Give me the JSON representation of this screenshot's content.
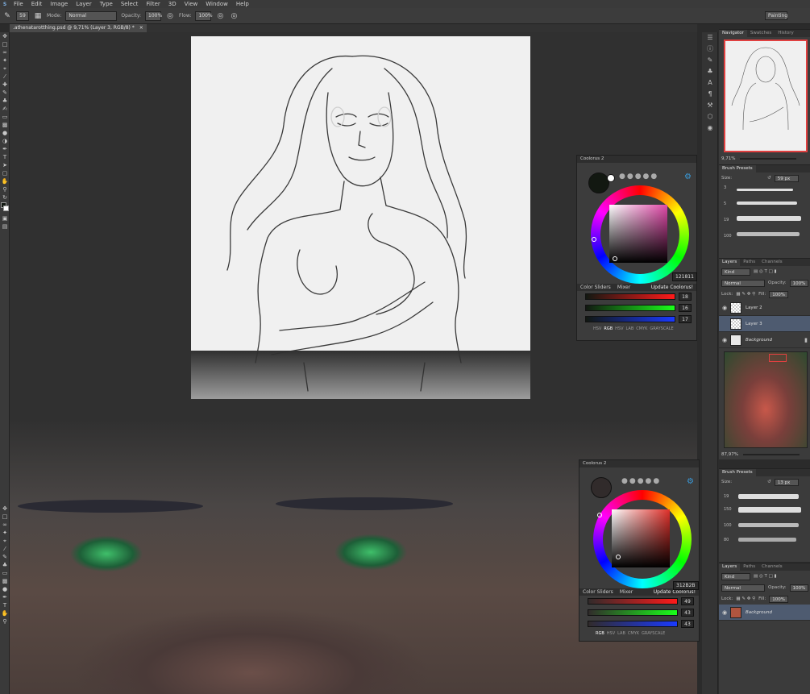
{
  "menubar": {
    "logo": "S",
    "items": [
      "File",
      "Edit",
      "Image",
      "Layer",
      "Type",
      "Select",
      "Filter",
      "3D",
      "View",
      "Window",
      "Help"
    ]
  },
  "options": {
    "brush_size": "59",
    "mode_label": "Mode:",
    "mode_value": "Normal",
    "opacity_label": "Opacity:",
    "opacity_value": "100%",
    "flow_label": "Flow:",
    "flow_value": "100%",
    "workspace": "Painting"
  },
  "document": {
    "tab_title": ".athenatarotthing.psd @ 9,71% (Layer 3, RGB/8) *",
    "close": "×"
  },
  "navigator": {
    "tabs": [
      "Navigator",
      "Swatches",
      "History"
    ],
    "zoom": "9,71%"
  },
  "navigator2": {
    "zoom": "87,97%"
  },
  "brush_presets": {
    "title": "Brush Presets",
    "size_label": "Size:",
    "size_value": "59 px",
    "sizes": [
      "3",
      "5",
      "19",
      "100"
    ]
  },
  "brush_presets2": {
    "title": "Brush Presets",
    "size_label": "Size:",
    "size_value": "13 px",
    "sizes": [
      "19",
      "150",
      "100",
      "80"
    ]
  },
  "layers": {
    "tabs": [
      "Layers",
      "Paths",
      "Channels"
    ],
    "kind": "Kind",
    "blend": "Normal",
    "opacity_label": "Opacity:",
    "opacity_value": "100%",
    "lock_label": "Lock:",
    "fill_label": "Fill:",
    "fill_value": "100%",
    "items": [
      "Layer 2",
      "Layer 3",
      "Background"
    ]
  },
  "layers2": {
    "tabs": [
      "Layers",
      "Paths",
      "Channels"
    ],
    "kind": "Kind",
    "blend": "Normal",
    "opacity_label": "Opacity:",
    "opacity_value": "100%",
    "lock_label": "Lock:",
    "fill_label": "Fill:",
    "fill_value": "100%",
    "items": [
      "Background"
    ]
  },
  "coolorus1": {
    "title": "Coolorus 2",
    "hex": "121811",
    "tabs": [
      "Color Sliders",
      "Mixer"
    ],
    "update": "Update Coolorus!",
    "values": [
      "18",
      "16",
      "17"
    ],
    "modes": [
      "HSV",
      "RGB",
      "HSV",
      "LAB",
      "CMYK",
      "GRAYSCALE"
    ],
    "current_color": "#121811"
  },
  "coolorus2": {
    "title": "Coolorus 2",
    "hex": "312B2B",
    "tabs": [
      "Color Sliders",
      "Mixer"
    ],
    "update": "Update Coolorus!",
    "values": [
      "49",
      "43",
      "43"
    ],
    "modes": [
      "RGB",
      "HSV",
      "LAB",
      "CMYK",
      "GRAYSCALE"
    ],
    "current_color": "#312B2B"
  }
}
